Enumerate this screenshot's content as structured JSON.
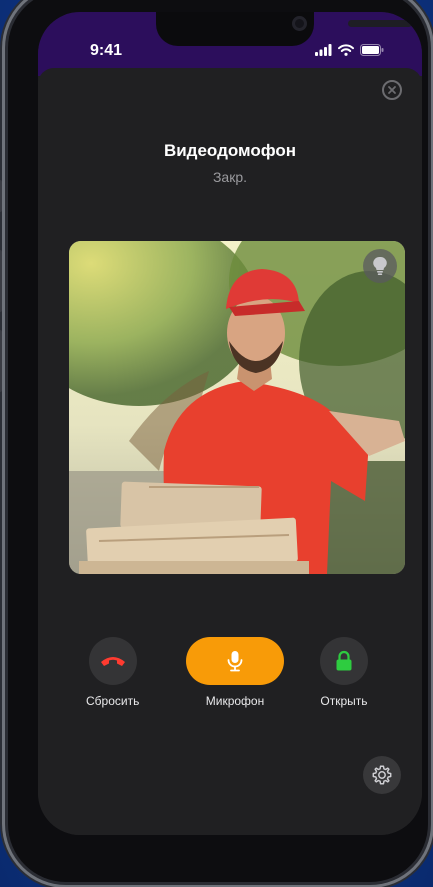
{
  "status_bar": {
    "time": "9:41",
    "signal_icon": "signal-icon",
    "wifi_icon": "wifi-icon",
    "battery_icon": "battery-icon"
  },
  "header": {
    "title": "Видеодомофон",
    "status": "Закр.",
    "close_icon": "close-icon"
  },
  "video": {
    "light_icon": "light-bulb-icon"
  },
  "controls": [
    {
      "label": "Сбросить",
      "icon": "phone-hangup-icon",
      "color": "#ff3b30"
    },
    {
      "label": "Микрофон",
      "icon": "microphone-icon",
      "color": "#f89b08"
    },
    {
      "label": "Открыть",
      "icon": "lock-icon",
      "color": "#2ecc40"
    }
  ],
  "settings": {
    "icon": "gear-icon"
  },
  "colors": {
    "accent": "#f89b08",
    "background": "#202022",
    "status_bar": "#2c0e5c"
  }
}
